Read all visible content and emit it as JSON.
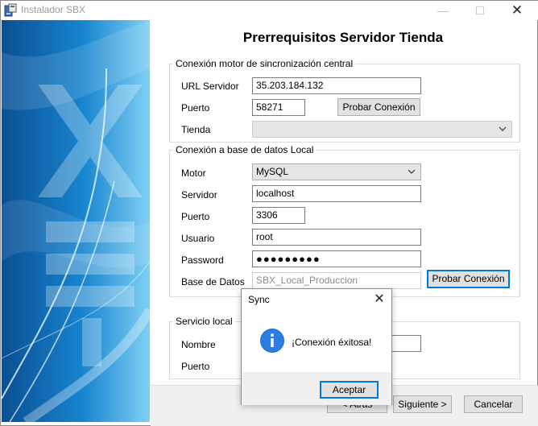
{
  "window": {
    "title": "Instalador SBX",
    "minimize_icon": "—",
    "maximize_icon": "☐",
    "close_icon": "✕"
  },
  "page": {
    "title": "Prerrequisitos Servidor Tienda"
  },
  "central": {
    "legend": "Conexión motor de sincronización central",
    "url_label": "URL Servidor",
    "url_value": "35.203.184.132",
    "port_label": "Puerto",
    "port_value": "58271",
    "test_button_label": "Probar Conexión",
    "store_label": "Tienda",
    "store_value": ""
  },
  "local_db": {
    "legend": "Conexión a base de datos Local",
    "engine_label": "Motor",
    "engine_value": "MySQL",
    "server_label": "Servidor",
    "server_value": "localhost",
    "port_label": "Puerto",
    "port_value": "3306",
    "user_label": "Usuario",
    "user_value": "root",
    "password_label": "Password",
    "password_value": "●●●●●●●●●",
    "database_label": "Base de Datos",
    "database_value": "SBX_Local_Produccion",
    "test_button_label": "Probar Conexión"
  },
  "local_service": {
    "legend": "Servicio local",
    "name_label": "Nombre",
    "port_label": "Puerto"
  },
  "footer": {
    "back_label": "< Atrás",
    "next_label": "Siguiente >",
    "cancel_label": "Cancelar"
  },
  "dialog": {
    "title": "Sync",
    "close_icon": "✕",
    "icon": "information-icon",
    "message": "¡Conexión éxitosa!",
    "ok_label": "Aceptar"
  },
  "colors": {
    "accent": "#0078d7",
    "banner_dark": "#0b5fa5",
    "banner_light": "#5fc0ee"
  }
}
